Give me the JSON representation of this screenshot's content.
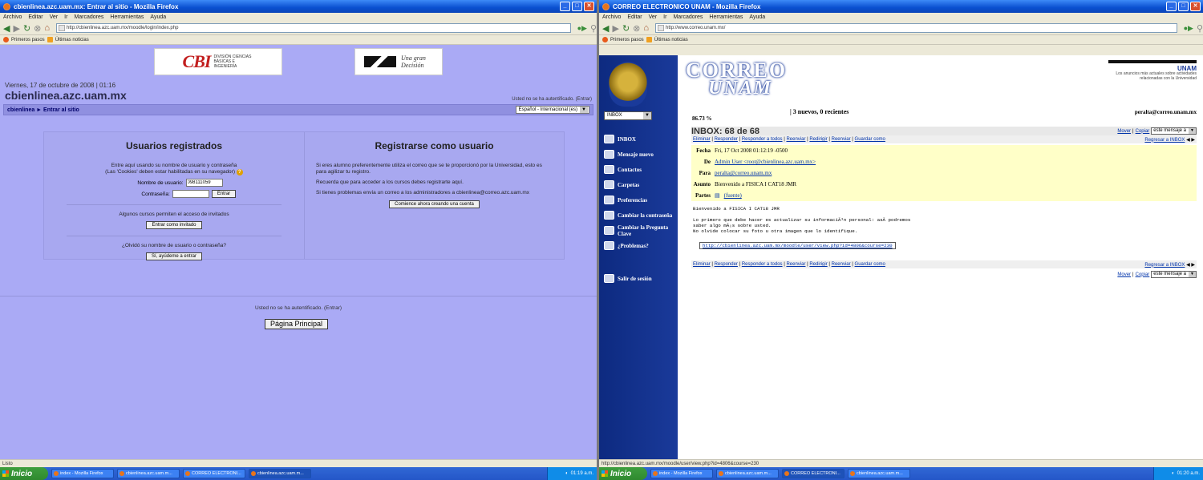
{
  "left": {
    "window_title": "cbienlinea.azc.uam.mx: Entrar al sitio - Mozilla Firefox",
    "menu": [
      "Archivo",
      "Editar",
      "Ver",
      "Ir",
      "Marcadores",
      "Herramientas",
      "Ayuda"
    ],
    "url": "http://cbienlinea.azc.uam.mx/moodle/login/index.php",
    "bookmarks": [
      "Primeros pasos",
      "Últimas noticias"
    ],
    "logo_cbi": "CBI",
    "logo_cbi_sub": "DIVISIÓN CIENCIAS BÁSICAS E INGENIERÍA",
    "logo_uam_slogan": "Una gran Decisión",
    "date": "Viernes, 17 de octubre de 2008 | 01:16",
    "site_title": "cbienlinea.azc.uam.mx",
    "auth_status": "Usted no se ha autentificado. (Entrar)",
    "breadcrumb": "cbienlinea ► Entrar al sitio",
    "language": "Español - Internacional (es)",
    "login": {
      "heading": "Usuarios registrados",
      "intro": "Entre aquí usando su nombre de usuario y contraseña",
      "cookies": "(Las 'Cookies' deben estar habilitadas en su navegador)",
      "username_label": "Nombre de usuario:",
      "username_value": "098111059",
      "password_label": "Contraseña:",
      "enter_button": "Entrar",
      "guest_text": "Algunos cursos permiten el acceso de invitados",
      "guest_button": "Entrar como invitado",
      "forgot_text": "¿Olvidó su nombre de usuario o contraseña?",
      "forgot_button": "Sí, ayúdeme a entrar"
    },
    "register": {
      "heading": "Registrarse como usuario",
      "p1": "Si eres alumno preferentemente utiliza el correo que se te proporcionó por la Universidad, esto es para agilizar tu registro.",
      "p2": "Recuerda que para acceder a los cursos debes registrarte aquí.",
      "p3": "Si tienes problemas envía un correo a los administradores a cbienlinea@correo.azc.uam.mx",
      "button": "Comience ahora creando una cuenta"
    },
    "footer_auth": "Usted no se ha autentificado. (Entrar)",
    "home_button": "Página Principal",
    "status": "Listo"
  },
  "right": {
    "window_title": "CORREO ELECTRONICO UNAM - Mozilla Firefox",
    "menu": [
      "Archivo",
      "Editar",
      "Ver",
      "Ir",
      "Marcadores",
      "Herramientas",
      "Ayuda"
    ],
    "url": "http://www.correo.unam.mx/",
    "bookmarks": [
      "Primeros pasos",
      "Últimas noticias"
    ],
    "brand_top": "CORREO",
    "brand_bottom": "UNAM",
    "dgsca_logo": "UNAM",
    "dgsca_text": "Los anuncios más actuales sobre actividades relacionadas con la Universidad",
    "folder_select": "INBOX",
    "quota": "86.73 %",
    "new_messages": "| 3 nuevos, 0 recientes",
    "user_email": "peralta@correo.unam.mx",
    "nav": [
      "INBOX",
      "Mensaje nuevo",
      "Contactos",
      "Carpetas",
      "Preferencias",
      "Cambiar la contraseña",
      "Cambiar la Pregunta Clave",
      "¿Problemas?"
    ],
    "logout": "Salir de sesión",
    "message": {
      "title": "INBOX: 68 de 68",
      "move": "Mover",
      "copy": "Copiar",
      "move_target": "este mensaje a",
      "actions": [
        "Eliminar",
        "Responder",
        "Responder a todos",
        "Reenviar",
        "Redirigir",
        "Reenviar",
        "Guardar como"
      ],
      "back": "Regresar a INBOX",
      "date_label": "Fecha",
      "date": "Fri, 17 Oct 2008 01:12:19 -0500",
      "from_label": "De",
      "from": "Admin User <root@cbienlinea.azc.uam.mx>",
      "to_label": "Para",
      "to": "peralta@correo.unam.mx",
      "subject_label": "Asunto",
      "subject": "Bienvenido a FISICA I CAT18 JMR",
      "parts_label": "Partes",
      "parts": "(fuente)",
      "body_line1": "Bienvenido a FISICA I CAT18 JMR",
      "body_line2": "Lo primero que debe hacer es actualizar su informaciÃ³n personal: asÃ­ podremos",
      "body_line3": "saber algo mÃ¡s sobre usted.",
      "body_line4": "No olvide colocar su foto u otra imagen que lo identifique.",
      "link": "http://cbienlinea.azc.uam.mx/moodle/user/view.php?id=4806&course=230"
    },
    "status": "http://cbienlinea.azc.uam.mx/moodle/user/view.php?id=4806&course=230"
  },
  "taskbar": {
    "start": "Inicio",
    "buttons_left": [
      "index - Mozilla Firefox",
      "cbienlinea.azc.uam.m...",
      "CORREO ELECTRONI...",
      "cbienlinea.azc.uam.m..."
    ],
    "buttons_right": [
      "index - Mozilla Firefox",
      "cbienlinea.azc.uam.m...",
      "CORREO ELECTRONI...",
      "cbienlinea.azc.uam.m..."
    ],
    "clock_left": "01:19 a.m.",
    "clock_right": "01:20 a.m."
  }
}
